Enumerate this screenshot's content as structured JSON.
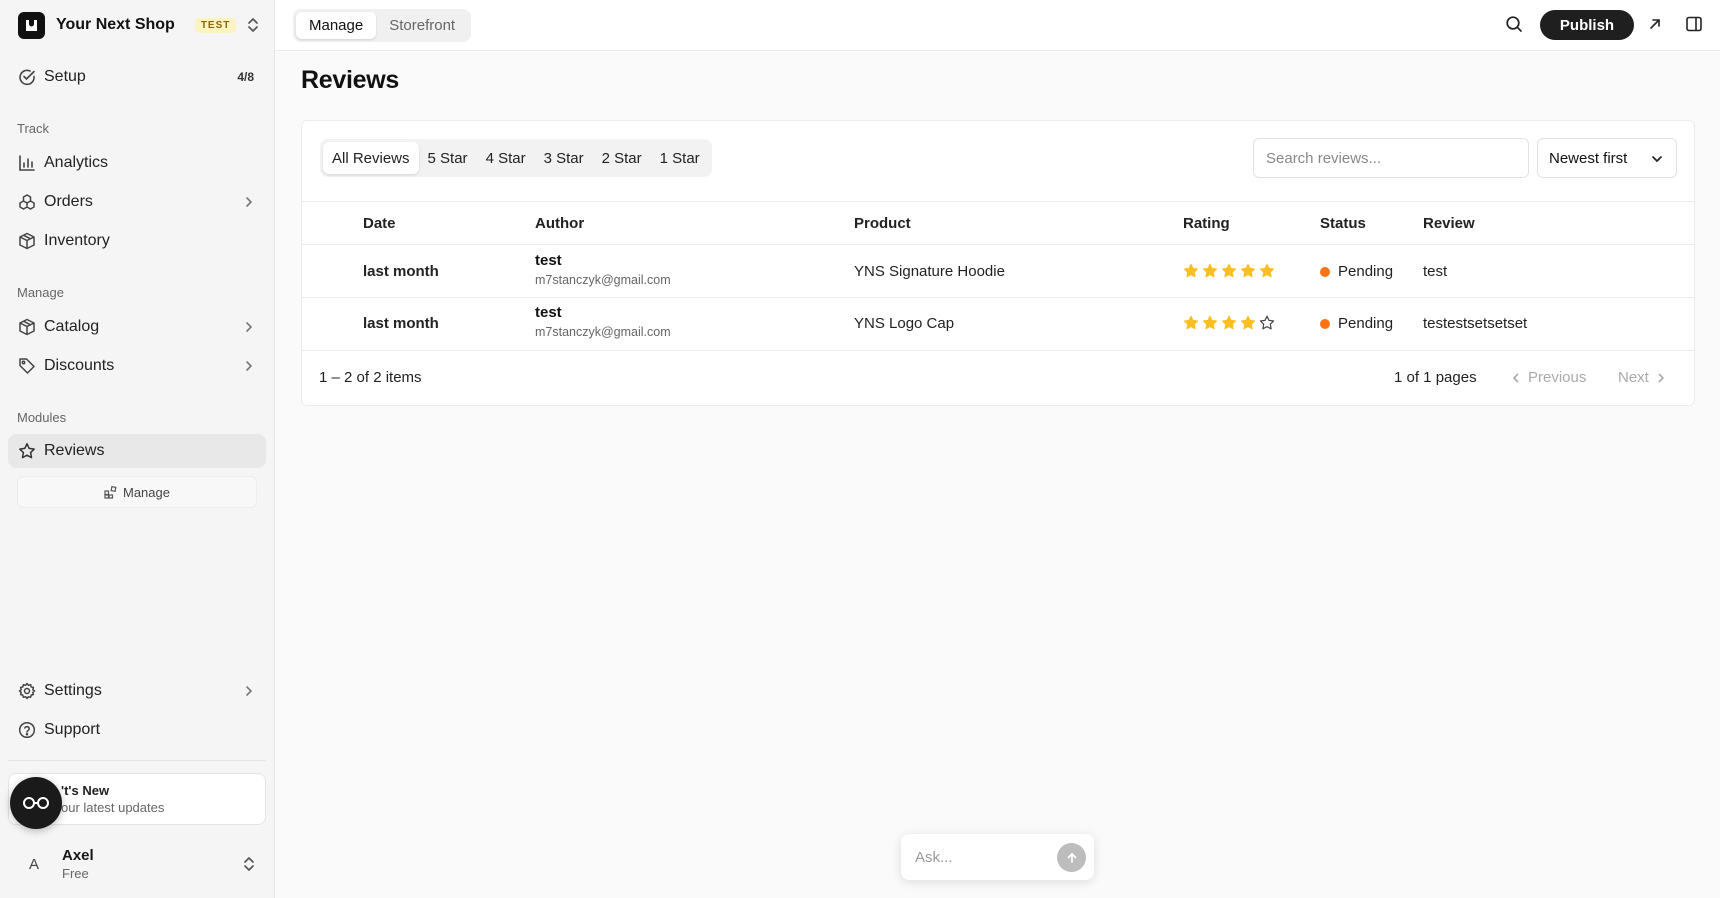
{
  "shop": {
    "name": "Your Next Shop",
    "badge": "TEST"
  },
  "sidebar": {
    "setup": {
      "label": "Setup",
      "count": "4/8"
    },
    "sections": {
      "track": "Track",
      "manage": "Manage",
      "modules": "Modules"
    },
    "items": {
      "analytics": "Analytics",
      "orders": "Orders",
      "inventory": "Inventory",
      "catalog": "Catalog",
      "discounts": "Discounts",
      "reviews": "Reviews",
      "settings": "Settings",
      "support": "Support"
    },
    "manage_sub": "Manage",
    "whats_new": {
      "title": "'t's New",
      "subtitle": "our latest updates"
    },
    "user": {
      "initial": "A",
      "name": "Axel",
      "plan": "Free"
    }
  },
  "topbar": {
    "tabs": [
      "Manage",
      "Storefront"
    ],
    "active_tab": "Manage",
    "publish_label": "Publish"
  },
  "page": {
    "title": "Reviews"
  },
  "filters": {
    "tabs": [
      "All Reviews",
      "5 Star",
      "4 Star",
      "3 Star",
      "2 Star",
      "1 Star"
    ],
    "active": "All Reviews",
    "search_placeholder": "Search reviews...",
    "sort_label": "Newest first"
  },
  "table": {
    "headers": {
      "date": "Date",
      "author": "Author",
      "product": "Product",
      "rating": "Rating",
      "status": "Status",
      "review": "Review"
    },
    "rows": [
      {
        "date": "last month",
        "author": "test",
        "email": "m7stanczyk@gmail.com",
        "product": "YNS Signature Hoodie",
        "rating": 5,
        "status": "Pending",
        "review": "test"
      },
      {
        "date": "last month",
        "author": "test",
        "email": "m7stanczyk@gmail.com",
        "product": "YNS Logo Cap",
        "rating": 4,
        "status": "Pending",
        "review": "testestsetsetset"
      }
    ]
  },
  "pagination": {
    "summary": "1 – 2 of 2 items",
    "pages": "1 of 1 pages",
    "previous": "Previous",
    "next": "Next"
  },
  "ask": {
    "placeholder": "Ask..."
  },
  "colors": {
    "star": "#fbbf24",
    "pending": "#f97316",
    "accent": "#1f1f1f"
  }
}
